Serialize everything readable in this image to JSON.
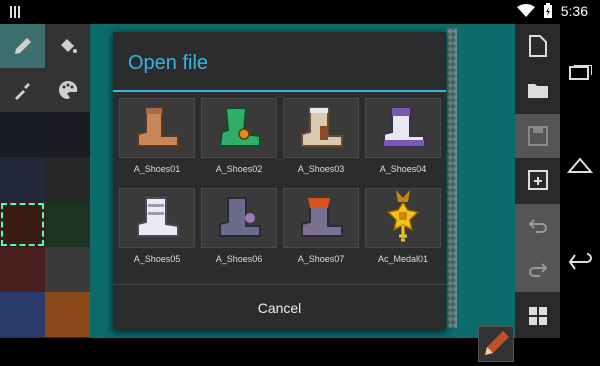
{
  "statusbar": {
    "time": "5:36"
  },
  "dialog": {
    "title": "Open file",
    "cancel_label": "Cancel",
    "files": [
      {
        "name": "A_Shoes01",
        "color": "#c8875a",
        "accent": "#a86a44"
      },
      {
        "name": "A_Shoes02",
        "color": "#2fae6a",
        "accent": "#e08a20"
      },
      {
        "name": "A_Shoes03",
        "color": "#d9c9b0",
        "accent": "#8a4a2a"
      },
      {
        "name": "A_Shoes04",
        "color": "#e8e8f0",
        "accent": "#7a5ab0"
      },
      {
        "name": "A_Shoes05",
        "color": "#eaeaf2",
        "accent": "#9a9aa8"
      },
      {
        "name": "A_Shoes06",
        "color": "#6a6a8a",
        "accent": "#9a7ab8"
      },
      {
        "name": "A_Shoes07",
        "color": "#7a7090",
        "accent": "#d8501a"
      },
      {
        "name": "Ac_Medal01",
        "color": "#f2c21a",
        "accent": "#c8860e"
      }
    ]
  },
  "colors": {
    "accent": "#33b5e5",
    "background": "#0c6b6b",
    "palette": [
      "#1a1d26",
      "#1f1b24",
      "#22273a",
      "#262626",
      "#3a1c14",
      "#1a3322",
      "#4a1e1e",
      "#3a3a3a",
      "#2a3a6a",
      "#8a4a1a"
    ]
  },
  "icons": {
    "left_tools": [
      "pencil-icon",
      "fill-bucket-icon",
      "eyedropper-icon",
      "palette-icon"
    ],
    "right_tools": [
      "new-file-icon",
      "open-folder-icon",
      "save-icon",
      "save-as-icon",
      "undo-icon",
      "redo-icon",
      "grid-icon"
    ],
    "nav": [
      "recent-apps-icon",
      "home-icon",
      "back-icon"
    ]
  }
}
